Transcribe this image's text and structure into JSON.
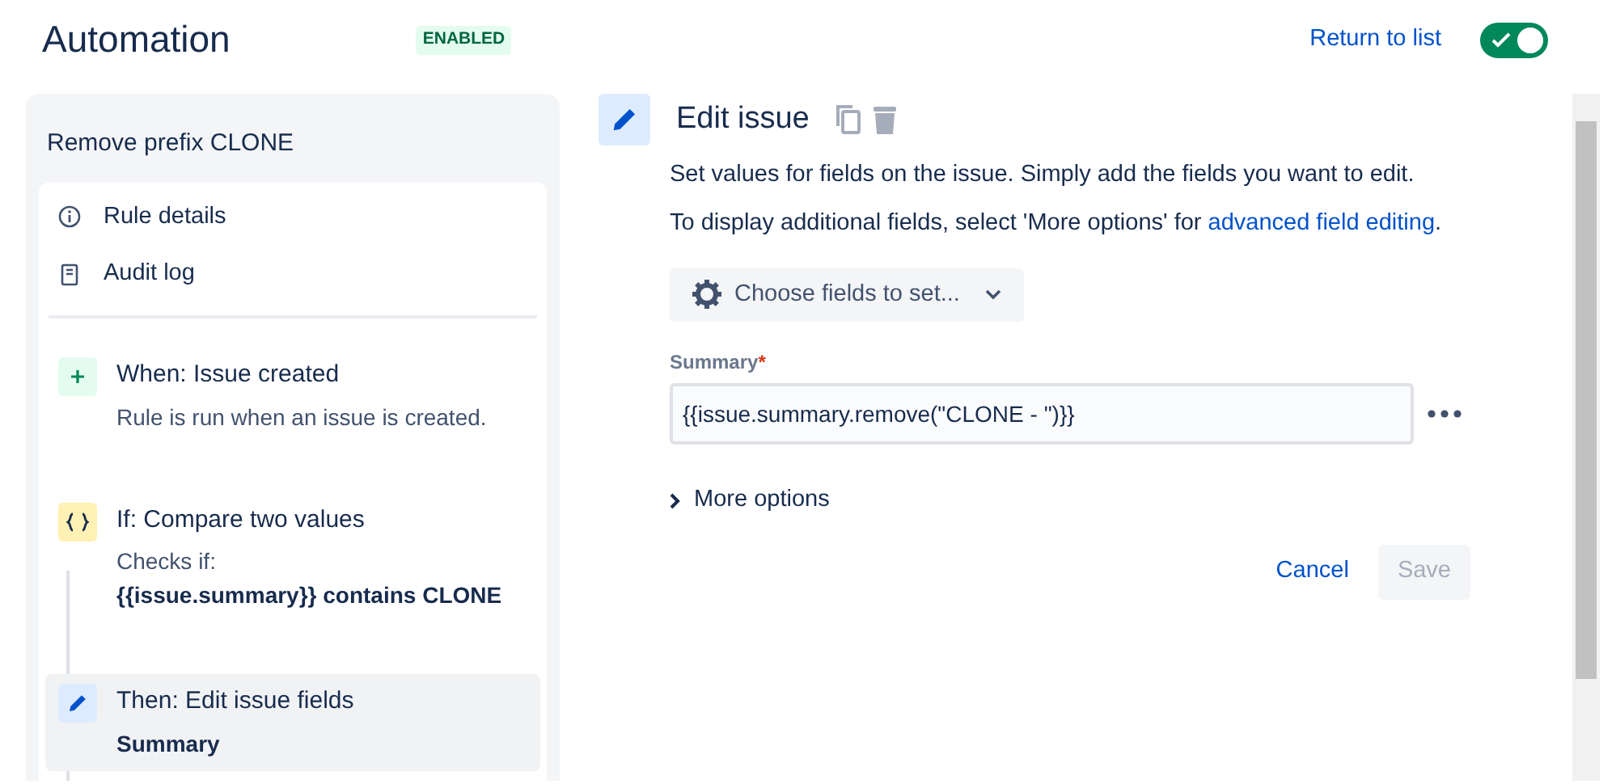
{
  "header": {
    "title": "Automation",
    "status_badge": "ENABLED",
    "return_link": "Return to list",
    "toggle": {
      "on": true
    }
  },
  "rule": {
    "name": "Remove prefix CLONE",
    "menu": [
      {
        "kind": "info",
        "label": "Rule details"
      },
      {
        "kind": "log",
        "label": "Audit log"
      }
    ],
    "steps": [
      {
        "kind": "trigger",
        "title": "When: Issue created",
        "selected": false,
        "lines": [
          {
            "text": "Rule is run when an issue is created.",
            "bold": false
          }
        ]
      },
      {
        "kind": "condition",
        "title": "If: Compare two values",
        "selected": false,
        "lines": [
          {
            "text": "Checks if:",
            "bold": false
          },
          {
            "text": "{{issue.summary}} contains CLONE",
            "bold": true
          }
        ]
      },
      {
        "kind": "action",
        "title": "Then: Edit issue fields",
        "selected": true,
        "lines": [
          {
            "text": "Summary",
            "bold": true
          }
        ]
      }
    ]
  },
  "editor": {
    "title": "Edit issue",
    "description": "Set values for fields on the issue. Simply add the fields you want to edit.",
    "hint": "To display additional fields, select 'More options' for ",
    "hint_link": "advanced field editing",
    "hint_end": ".",
    "choose_button": "Choose fields to set...",
    "field": {
      "label": "Summary",
      "required_mark": "*",
      "value": "{{issue.summary.remove(\"CLONE - \")}}"
    },
    "more_options": {
      "label": "More options",
      "expanded": false
    },
    "cancel": "Cancel",
    "save": {
      "label": "Save",
      "disabled": true
    }
  }
}
